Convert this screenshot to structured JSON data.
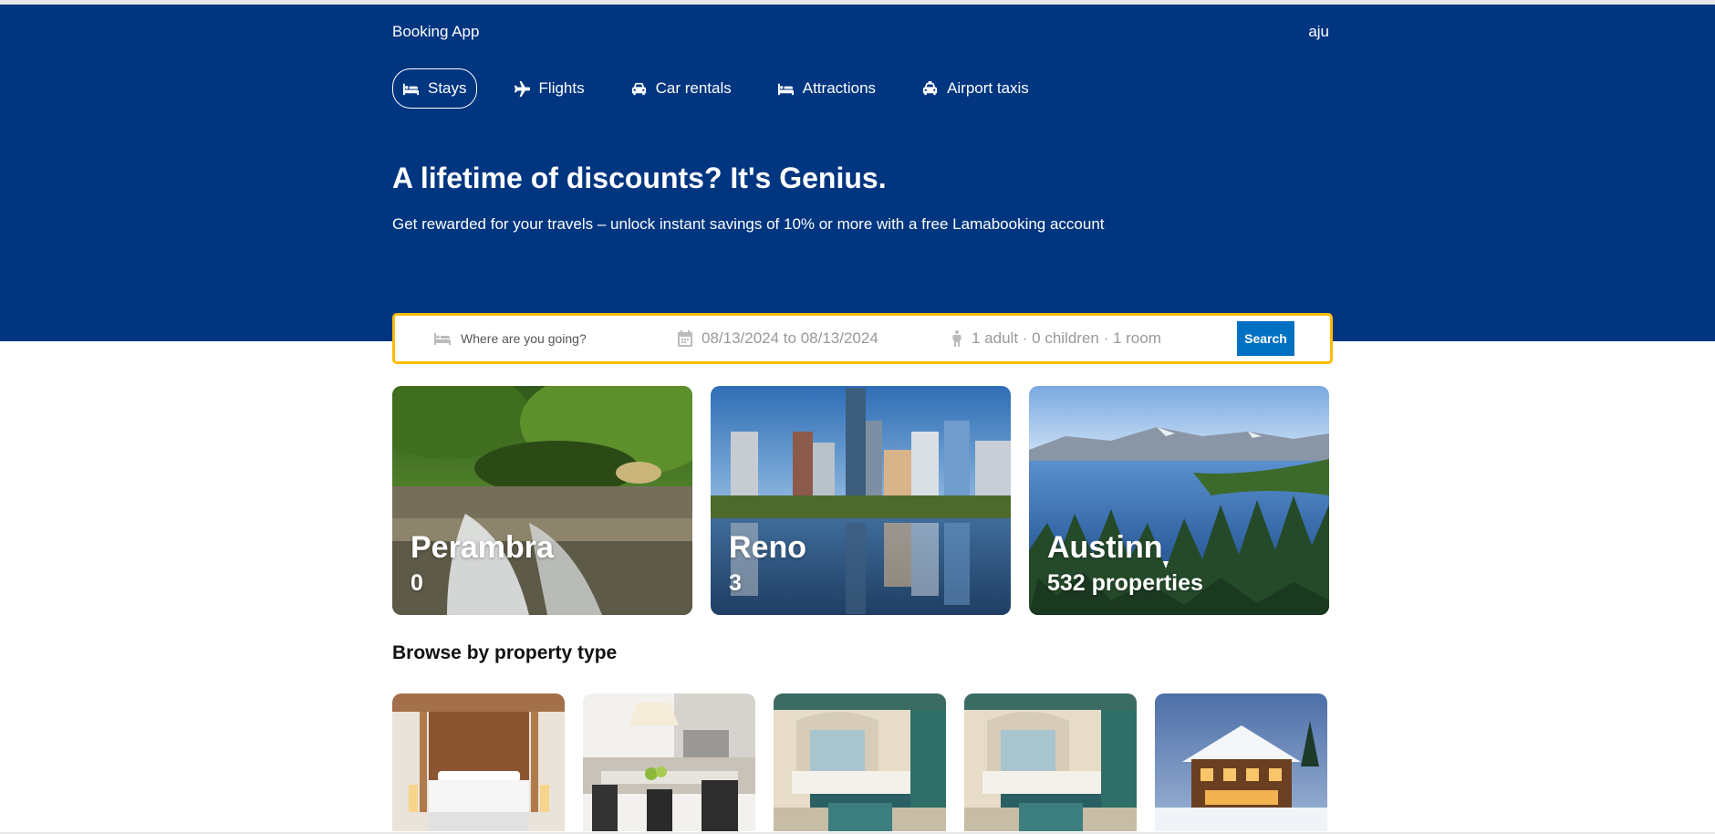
{
  "navbar": {
    "logo": "Booking App",
    "user": "aju"
  },
  "tabs": [
    {
      "label": "Stays",
      "icon": "bed-icon",
      "active": true
    },
    {
      "label": "Flights",
      "icon": "plane-icon",
      "active": false
    },
    {
      "label": "Car rentals",
      "icon": "car-icon",
      "active": false
    },
    {
      "label": "Attractions",
      "icon": "bed-icon",
      "active": false
    },
    {
      "label": "Airport taxis",
      "icon": "taxi-icon",
      "active": false
    }
  ],
  "hero": {
    "title": "A lifetime of discounts? It's Genius.",
    "subtitle": "Get rewarded for your travels – unlock instant savings of 10% or more with a free Lamabooking account"
  },
  "search": {
    "destination_placeholder": "Where are you going?",
    "dates": "08/13/2024 to 08/13/2024",
    "options": "1 adult · 0 children · 1 room",
    "button": "Search"
  },
  "featured": [
    {
      "title": "Perambra",
      "subtitle": "0",
      "image": "waterfall"
    },
    {
      "title": "Reno",
      "subtitle": "3",
      "image": "city-skyline"
    },
    {
      "title": "Austinn",
      "subtitle": "532 properties",
      "image": "lake-mountains"
    }
  ],
  "browse": {
    "title": "Browse by property type",
    "items": [
      {
        "image": "hotel-bedroom"
      },
      {
        "image": "kitchen"
      },
      {
        "image": "resort-room"
      },
      {
        "image": "resort-room"
      },
      {
        "image": "snowy-cabin"
      }
    ]
  },
  "colors": {
    "header": "#003580",
    "search_border": "#febb02",
    "button": "#0071c2"
  }
}
